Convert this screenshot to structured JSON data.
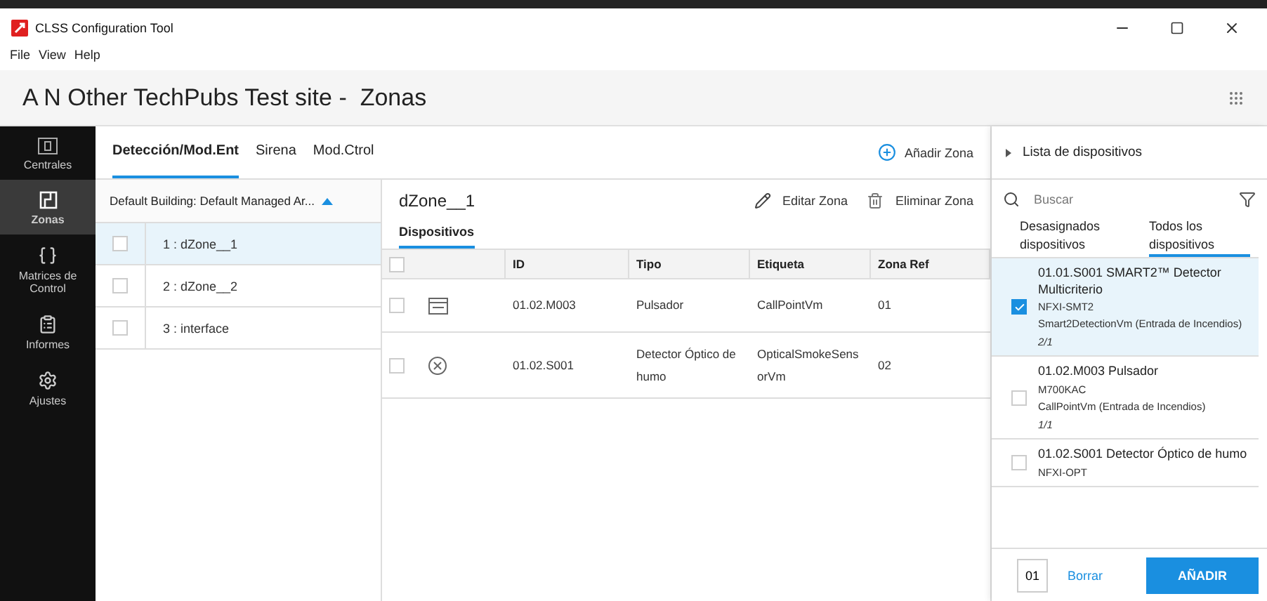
{
  "window": {
    "title": "CLSS Configuration Tool"
  },
  "menu": [
    "File",
    "View",
    "Help"
  ],
  "header": {
    "title": "A N Other TechPubs Test site -  Zonas"
  },
  "nav": [
    {
      "kind": "panel",
      "label": "Centrales",
      "selected": false
    },
    {
      "kind": "zone",
      "label": "Zonas",
      "selected": true
    },
    {
      "kind": "matrix",
      "label": "Matrices de Control",
      "selected": false
    },
    {
      "kind": "report",
      "label": "Informes",
      "selected": false
    },
    {
      "kind": "settings",
      "label": "Ajustes",
      "selected": false
    }
  ],
  "tabs": [
    {
      "label": "Detección/Mod.Ent",
      "selected": true
    },
    {
      "label": "Sirena",
      "selected": false
    },
    {
      "label": "Mod.Ctrol",
      "selected": false
    }
  ],
  "add_zone": "Añadir Zona",
  "zone_list": {
    "header": "Default Building: Default Managed Ar...",
    "expanded": true,
    "zones": [
      {
        "label": "1 : dZone__1",
        "selected": true,
        "checked": false
      },
      {
        "label": "2 : dZone__2",
        "selected": false,
        "checked": false
      },
      {
        "label": "3 : interface",
        "selected": false,
        "checked": false
      }
    ]
  },
  "zone_detail": {
    "title": "dZone__1",
    "actions": [
      {
        "kind": "edit",
        "label": "Editar Zona"
      },
      {
        "kind": "delete",
        "label": "Eliminar Zona"
      }
    ],
    "tabs": [
      {
        "label": "Dispositivos",
        "selected": true
      }
    ],
    "table": {
      "all_checked": false,
      "columns": [
        "ID",
        "Tipo",
        "Etiqueta",
        "Zona Ref"
      ],
      "rows": [
        {
          "kind": "callpoint",
          "checked": false,
          "cells": [
            "01.02.M003",
            "Pulsador",
            "CallPointVm",
            "01"
          ]
        },
        {
          "kind": "smoke",
          "checked": false,
          "cells": [
            "01.02.S001",
            "Detector Óptico de humo",
            "OpticalSmokeSensorVm",
            "02"
          ]
        }
      ]
    }
  },
  "device_list": {
    "title": "Lista de dispositivos",
    "search": {
      "placeholder": "Buscar"
    },
    "tabs": [
      {
        "label": "Desasignados dispositivos",
        "selected": false
      },
      {
        "label": "Todos los dispositivos",
        "selected": true
      }
    ],
    "items": [
      {
        "title": "01.01.S001 SMART2™ Detector Multicriterio",
        "model": "NFXI-SMT2",
        "detail": "Smart2DetectionVm (Entrada de Incendios)",
        "count": "2/1",
        "checked": true
      },
      {
        "title": "01.02.M003 Pulsador",
        "model": "M700KAC",
        "detail": "CallPointVm (Entrada de Incendios)",
        "count": "1/1",
        "checked": false
      },
      {
        "title": "01.02.S001 Detector Óptico de humo",
        "model": "NFXI-OPT",
        "checked": false
      }
    ],
    "footer": {
      "quantity": "01",
      "clear": "Borrar",
      "add": "AÑADIR"
    }
  }
}
